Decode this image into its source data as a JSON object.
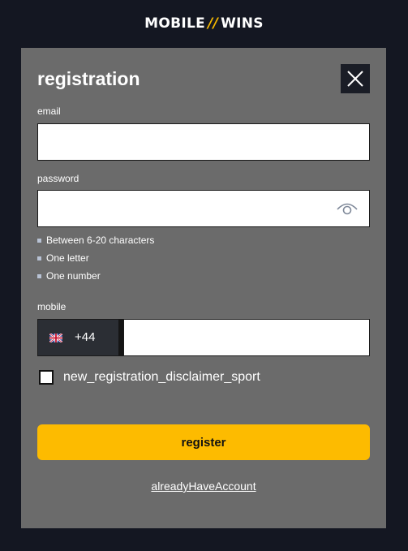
{
  "header": {
    "logo_left": "MOBILE",
    "logo_slash": "//",
    "logo_right": "WINS"
  },
  "modal": {
    "title": "registration",
    "close_icon": "close-icon"
  },
  "form": {
    "email_label": "email",
    "email_value": "",
    "password_label": "password",
    "password_value": "",
    "password_toggle_icon": "eye-icon",
    "password_rules": [
      "Between 6-20 characters",
      "One letter",
      "One number"
    ],
    "mobile_label": "mobile",
    "country_flag_icon": "uk-flag-icon",
    "country_code": "+44",
    "mobile_value": "",
    "disclaimer_checked": false,
    "disclaimer_label": "new_registration_disclaimer_sport",
    "register_label": "register",
    "login_link_label": "alreadyHaveAccount"
  },
  "colors": {
    "background": "#141722",
    "modal": "#6b6b6b",
    "accent": "#fdbb00",
    "bullet": "#b8c2d4"
  }
}
